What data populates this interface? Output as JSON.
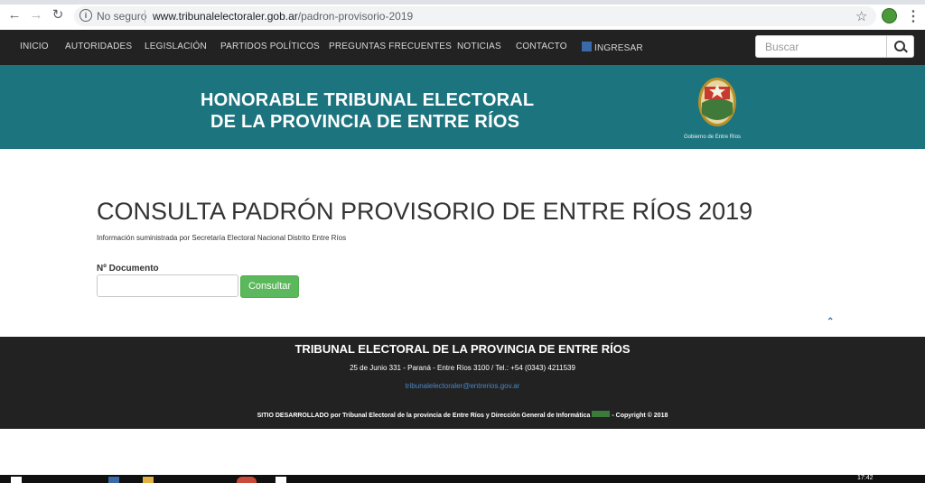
{
  "browser": {
    "security_label": "No seguro",
    "url_domain": "www.tribunalelectoraler.gob.ar",
    "url_path": "/padron-provisorio-2019"
  },
  "nav": {
    "items": [
      "INICIO",
      "AUTORIDADES",
      "LEGISLACIÓN",
      "PARTIDOS POLÍTICOS",
      "PREGUNTAS FRECUENTES",
      "NOTICIAS",
      "CONTACTO",
      "INGRESAR"
    ],
    "search_placeholder": "Buscar"
  },
  "banner": {
    "line1": "HONORABLE TRIBUNAL ELECTORAL",
    "line2": "DE LA PROVINCIA DE ENTRE RÍOS",
    "crest_caption": "Gobierno de Entre Ríos",
    "bg_color": "#1c747f"
  },
  "main": {
    "title": "CONSULTA PADRÓN PROVISORIO DE ENTRE RÍOS 2019",
    "subtitle": "Información suministrada por Secretaría Electoral Nacional Distrito Entre Ríos",
    "doc_label": "Nº Documento",
    "doc_value": "",
    "submit_label": "Consultar",
    "back_to_top": "⌃"
  },
  "footer": {
    "title": "TRIBUNAL ELECTORAL DE LA PROVINCIA DE ENTRE RÍOS",
    "address": "25 de Junio 331 - Paraná - Entre Ríos 3100 / Tel.: +54 (0343) 4211539",
    "email": "tribunalelectoraler@entrerios.gov.ar",
    "credits_left": "SITIO DESARROLLADO por Tribunal Electoral de la provincia de Entre Ríos y Dirección General de Informática",
    "credits_right": "- Copyright © 2018"
  },
  "taskbar": {
    "clock": "17:42"
  },
  "icons": {
    "back": "arrow-left-icon",
    "forward": "arrow-right-icon",
    "reload": "reload-icon",
    "info": "info-icon",
    "star": "star-icon",
    "menu": "kebab-menu-icon",
    "search": "search-icon"
  }
}
